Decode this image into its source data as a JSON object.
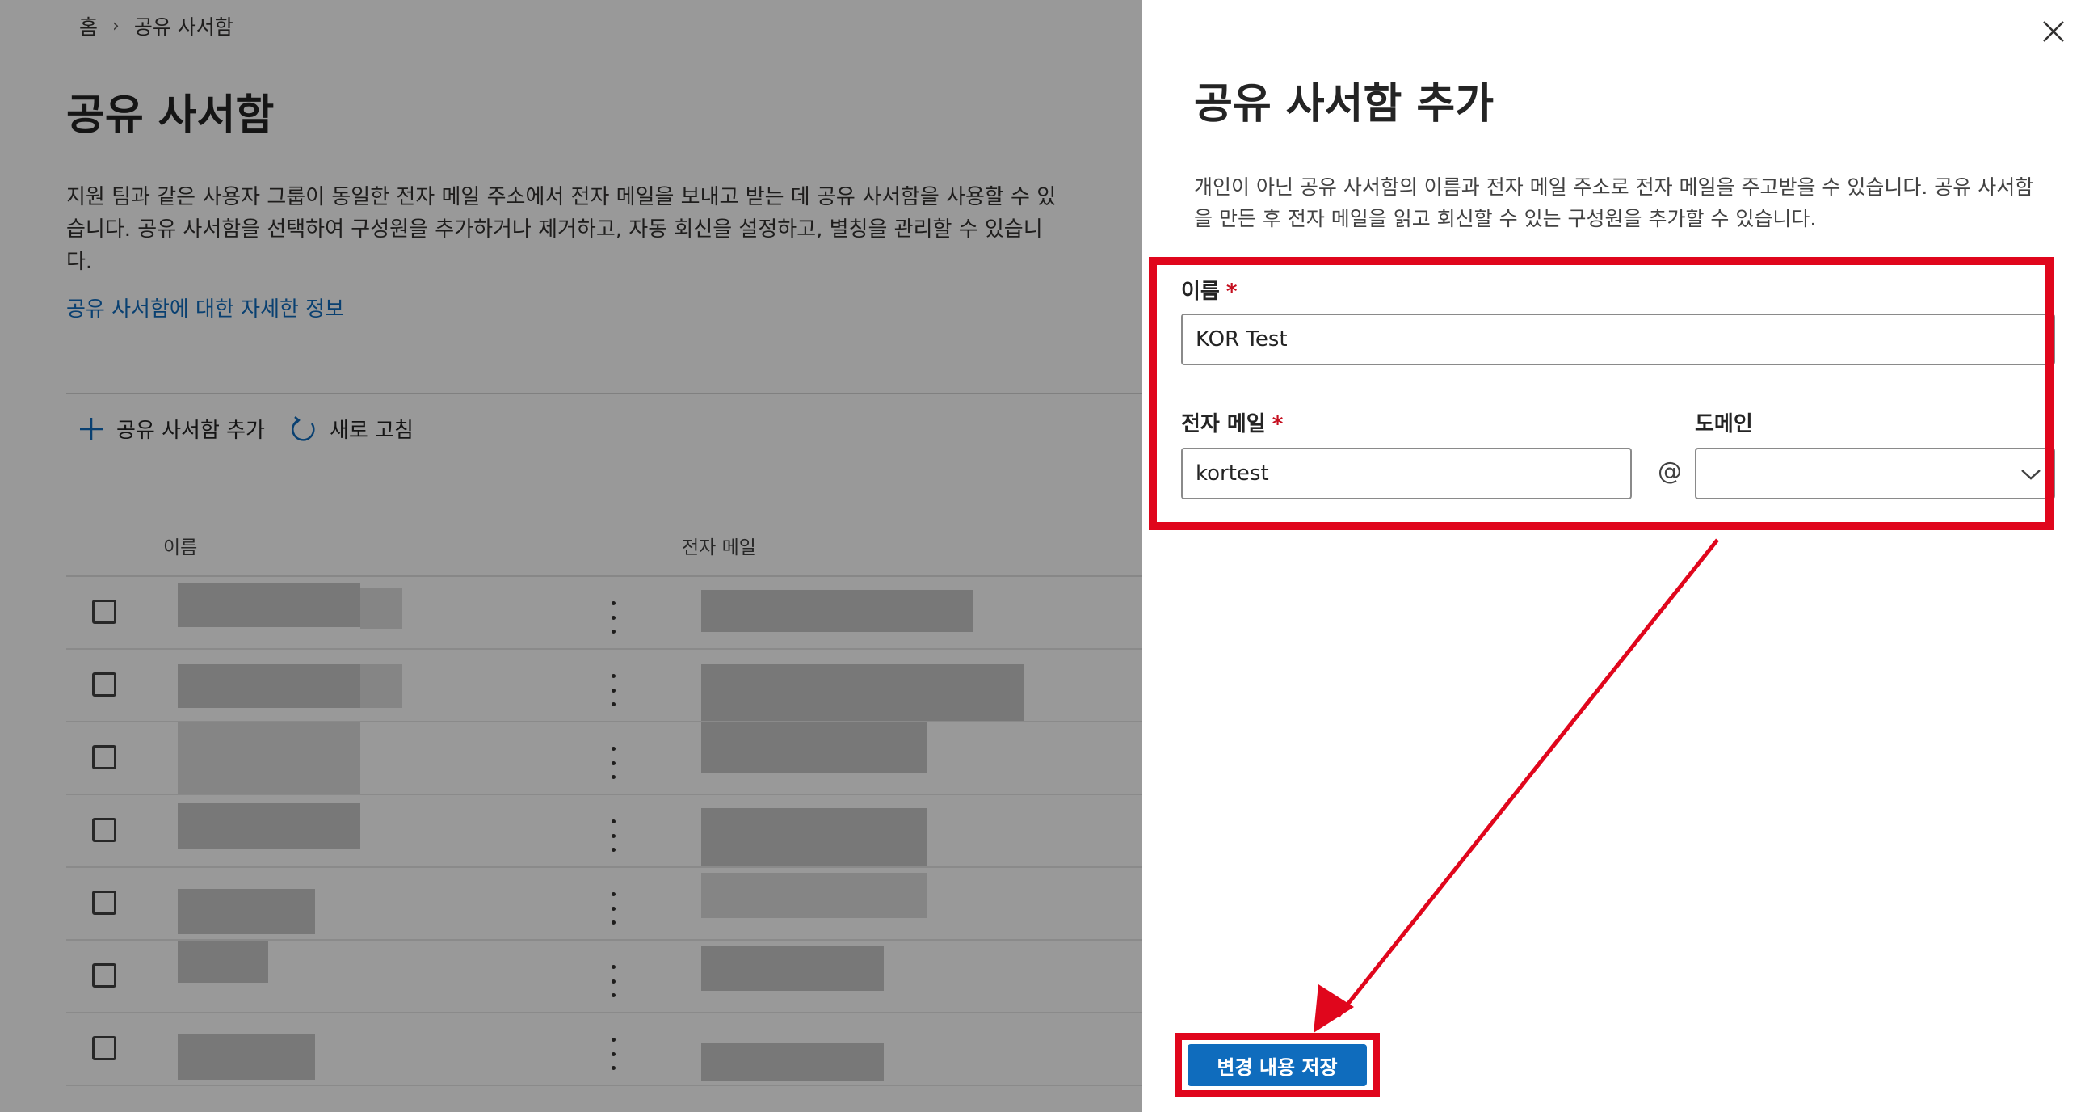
{
  "breadcrumb": {
    "home": "홈",
    "current": "공유 사서함"
  },
  "page": {
    "title": "공유 사서함",
    "description": "지원 팀과 같은 사용자 그룹이 동일한 전자 메일 주소에서 전자 메일을 보내고 받는 데 공유 사서함을 사용할 수 있습니다. 공유 사서함을 선택하여 구성원을 추가하거나 제거하고, 자동 회신을 설정하고, 별칭을 관리할 수 있습니다.",
    "learn_more": "공유 사서함에 대한 자세한 정보"
  },
  "toolbar": {
    "add_label": "공유 사서함 추가",
    "refresh_label": "새로 고침"
  },
  "table": {
    "columns": [
      "이름",
      "전자 메일"
    ],
    "row_count": 7
  },
  "panel": {
    "title": "공유 사서함 추가",
    "description": "개인이 아닌 공유 사서함의 이름과 전자 메일 주소로 전자 메일을 주고받을 수 있습니다. 공유 사서함을 만든 후 전자 메일을 읽고 회신할 수 있는 구성원을 추가할 수 있습니다.",
    "name_label": "이름",
    "name_value": "KOR Test",
    "email_label": "전자 메일",
    "email_value": "kortest",
    "at_sign": "@",
    "domain_label": "도메인",
    "domain_value": "",
    "required_mark": "*",
    "save_label": "변경 내용 저장"
  },
  "colors": {
    "accent": "#0f6cbd",
    "highlight": "#e0061c",
    "required": "#c50f1f"
  }
}
